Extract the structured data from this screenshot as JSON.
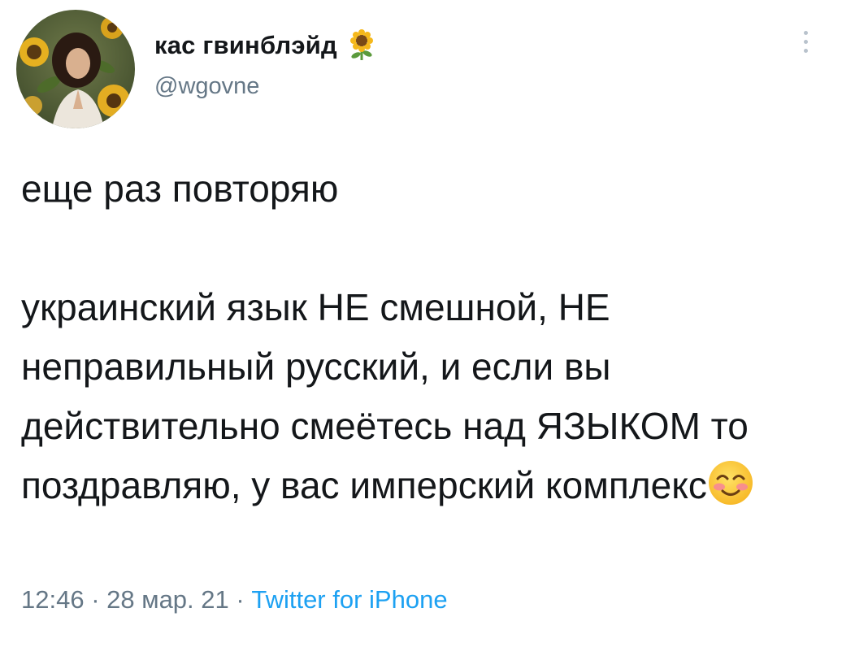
{
  "author": {
    "display_name": "кас гвинблэйд",
    "name_emoji": "sunflower-icon",
    "handle": "@wgovne",
    "avatar": "avatar-photo-sunflowers"
  },
  "menu_icon": "more-vertical-icon",
  "tweet": {
    "paragraphs": [
      "еще раз повторяю",
      "украинский язык НЕ смешной, НЕ неправильный русский, и если вы действительно смеётесь над ЯЗЫКОМ то поздравляю, у вас имперский комплекс"
    ],
    "trailing_emoji": "smiling-face-with-smiling-eyes-icon"
  },
  "meta": {
    "time": "12:46",
    "separator": "·",
    "date": "28 мар. 21",
    "source": "Twitter for iPhone"
  },
  "colors": {
    "text": "#14171a",
    "secondary": "#657786",
    "link": "#1da1f2"
  }
}
